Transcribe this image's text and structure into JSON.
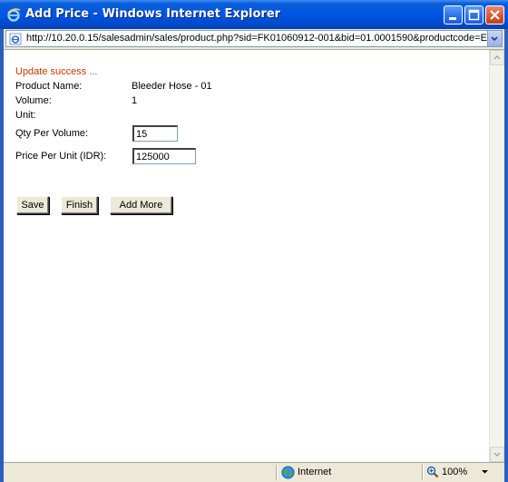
{
  "window": {
    "title": "Add Price - Windows Internet Explorer",
    "url": "http://10.20.0.15/salesadmin/sales/product.php?sid=FK01060912-001&bid=01.0001590&productcode=E"
  },
  "page": {
    "status_message": "Update success ...",
    "fields": [
      {
        "label": "Product Name:",
        "value": "Bleeder Hose - 01"
      },
      {
        "label": "Volume:",
        "value": "1"
      },
      {
        "label": "Unit:",
        "value": ""
      }
    ],
    "qty_label": "Qty Per Volume:",
    "qty_value": "15",
    "price_label": "Price Per Unit (IDR):",
    "price_value": "125000",
    "buttons": {
      "save": "Save",
      "finish": "Finish",
      "add_more": "Add More"
    }
  },
  "statusbar": {
    "zone": "Internet",
    "zoom": "100%"
  }
}
